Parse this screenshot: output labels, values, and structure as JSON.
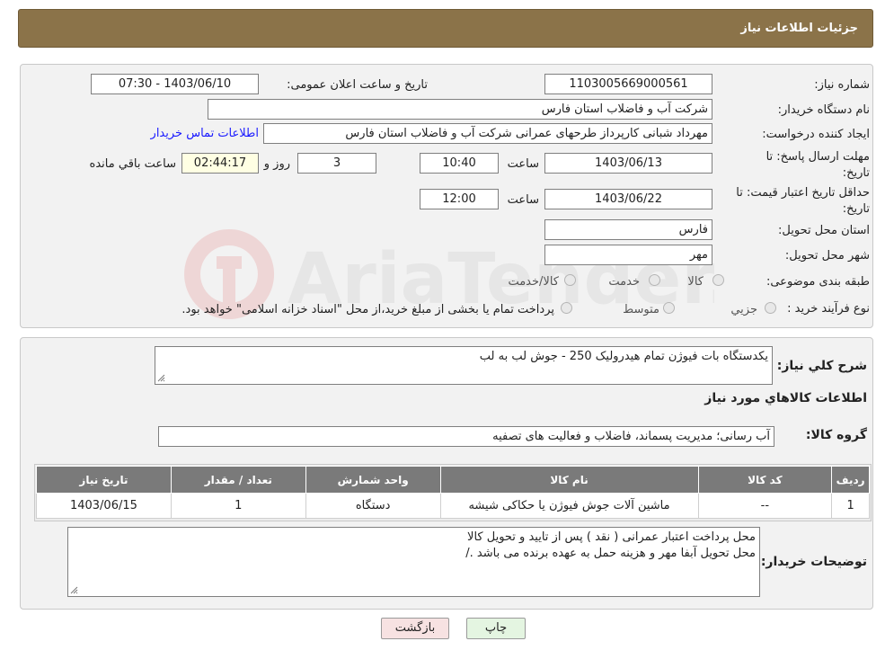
{
  "header": {
    "title": "جزئیات اطلاعات نیاز"
  },
  "need_number": {
    "label": "شماره نیاز:",
    "value": "1103005669000561"
  },
  "announce_datetime": {
    "label": "تاریخ و ساعت اعلان عمومی:",
    "value": "1403/06/10 - 07:30"
  },
  "buyer_org": {
    "label": "نام دستگاه خریدار:",
    "value": "شرکت آب و فاضلاب استان فارس"
  },
  "requester": {
    "label": "ایجاد کننده درخواست:",
    "value": "مهرداد شبانی کارپرداز طرحهای عمرانی  شرکت آب و فاضلاب استان فارس",
    "contact_link": "اطلاعات تماس خریدار"
  },
  "response_deadline": {
    "label_line1": "مهلت ارسال پاسخ: تا",
    "label_line2": "تاریخ:",
    "date": "1403/06/13",
    "time_label": "ساعت",
    "time": "10:40",
    "days": "3",
    "days_label": "روز و",
    "remaining": "02:44:17",
    "remaining_label": "ساعت باقي مانده"
  },
  "price_validity": {
    "label_line1": "حداقل تاریخ اعتبار قیمت: تا",
    "label_line2": "تاریخ:",
    "date": "1403/06/22",
    "time_label": "ساعت",
    "time": "12:00"
  },
  "delivery_province": {
    "label": "استان محل تحویل:",
    "value": "فارس"
  },
  "delivery_city": {
    "label": "شهر محل تحویل:",
    "value": "مهر"
  },
  "category": {
    "label": "طبقه بندی موضوعی:",
    "options": [
      "کالا",
      "خدمت",
      "کالا/خدمت"
    ]
  },
  "purchase_type": {
    "label": "نوع فرآیند خرید :",
    "options": [
      "جزيي",
      "متوسط"
    ],
    "note": "پرداخت تمام یا بخشی از مبلغ خرید،از محل \"اسناد خزانه اسلامی\" خواهد بود."
  },
  "watermark": {
    "text": "AriaTender.neT"
  },
  "need_summary": {
    "label": "شرح كلي نياز:",
    "value": "یکدستگاه بات فیوژن تمام هیدرولیک 250 - جوش لب به لب"
  },
  "goods_info": {
    "title": "اطلاعات كالاهاي مورد نياز"
  },
  "goods_group": {
    "label": "گروه كالا:",
    "value": "آب رسانی؛ مدیریت پسماند، فاضلاب و فعالیت های تصفیه"
  },
  "items_table": {
    "headers": [
      "رديف",
      "كد كالا",
      "نام كالا",
      "واحد شمارش",
      "تعداد / مقدار",
      "تاريخ نياز"
    ],
    "rows": [
      [
        "1",
        "--",
        "ماشین آلات جوش فیوژن یا حکاکی شیشه",
        "دستگاه",
        "1",
        "1403/06/15"
      ]
    ]
  },
  "buyer_notes": {
    "label": "توضيحات خريدار:",
    "line1": "محل پرداخت اعتبار عمرانی ( نقد ) پس از تایید و تحویل کالا",
    "line2": "محل تحویل آبفا مهر و هزینه حمل به عهده برنده می باشد ./"
  },
  "buttons": {
    "print": "چاپ",
    "back": "بازگشت"
  },
  "colors": {
    "header_bg": "#8b7349",
    "table_header_bg": "#7a7a7a",
    "link": "#1a1aff"
  }
}
